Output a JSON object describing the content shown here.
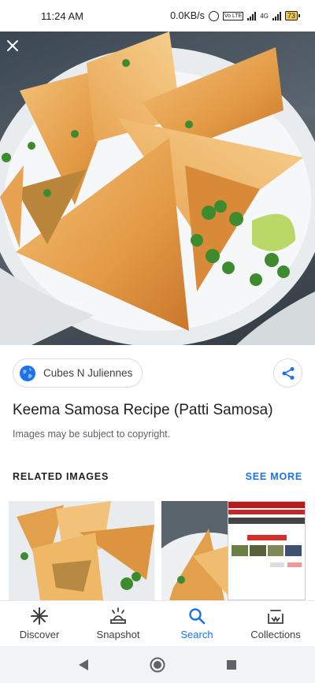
{
  "status_bar": {
    "time": "11:24 AM",
    "network_speed": "0.0KB/s",
    "network_type": "4G",
    "volte": "Vo LTE",
    "battery": "73",
    "icons": [
      "alarm-icon",
      "volte-icon",
      "signal-icon",
      "battery-icon"
    ]
  },
  "hero": {
    "close_icon": "close-icon",
    "image_subject": "samosas-in-bowl"
  },
  "source": {
    "name": "Cubes N Juliennes",
    "icon": "globe-icon"
  },
  "share_icon": "share-icon",
  "title": "Keema Samosa Recipe (Patti Samosa)",
  "copyright_notice": "Images may be subject to copyright.",
  "related": {
    "header": "RELATED IMAGES",
    "see_more": "SEE MORE"
  },
  "bottom_nav": {
    "items": [
      {
        "label": "Discover",
        "icon": "asterisk-icon"
      },
      {
        "label": "Snapshot",
        "icon": "snapshot-icon"
      },
      {
        "label": "Search",
        "icon": "search-icon"
      },
      {
        "label": "Collections",
        "icon": "collections-icon"
      }
    ],
    "active": "Search"
  },
  "system_nav": {
    "icons": [
      "back-icon",
      "home-icon",
      "recents-icon"
    ]
  },
  "colors": {
    "accent": "#1a73e8",
    "text": "#202124",
    "secondary_text": "#5f6368"
  }
}
